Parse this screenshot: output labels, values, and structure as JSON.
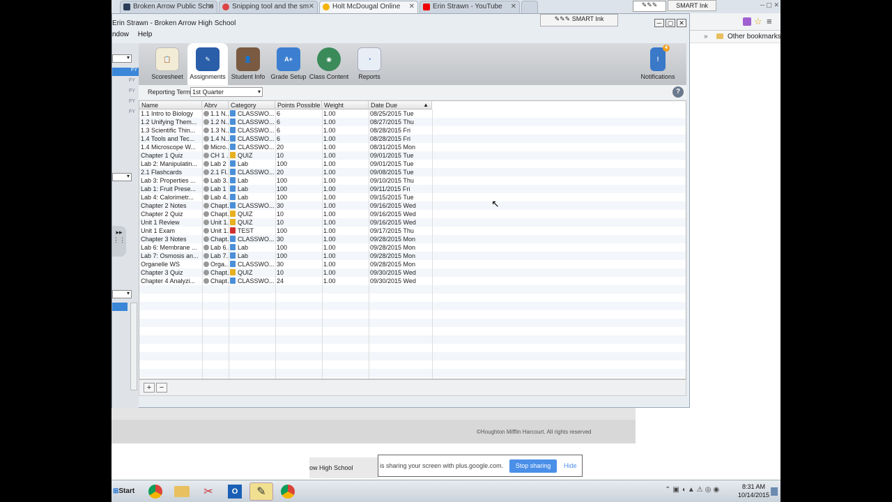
{
  "browser": {
    "tabs": [
      {
        "label": "Broken Arrow Public Scho",
        "color": "#2d3e5a"
      },
      {
        "label": "Snipping tool and the sm",
        "color": "#d44"
      },
      {
        "label": "Holt McDougal Online",
        "color": "#f5b400"
      },
      {
        "label": "Erin Strawn - YouTube",
        "color": "#e00"
      }
    ],
    "smart_ink": "SMART Ink",
    "bookmarks": "Other bookmarks"
  },
  "window": {
    "title": "Erin Strawn - Broken Arrow High School",
    "menu": [
      "ndow",
      "Help"
    ],
    "smart_ink": "SMART Ink"
  },
  "toolbar": {
    "items": [
      {
        "label": "Scoresheet",
        "icon": "scoresheet-icon"
      },
      {
        "label": "Assignments",
        "icon": "assignments-icon"
      },
      {
        "label": "Student Info",
        "icon": "student-info-icon"
      },
      {
        "label": "Grade Setup",
        "icon": "grade-setup-icon"
      },
      {
        "label": "Class Content",
        "icon": "class-content-icon"
      },
      {
        "label": "Reports",
        "icon": "reports-icon"
      }
    ],
    "notifications_label": "Notifications",
    "notifications_count": "4"
  },
  "reporting": {
    "label": "Reporting Term:",
    "value": "1st Quarter"
  },
  "left_labels": [
    "FY",
    "FY",
    "FY",
    "FY",
    "FY"
  ],
  "grid": {
    "columns": [
      "Name",
      "Abrv",
      "Category",
      "Points Possible",
      "Weight",
      "Date Due"
    ],
    "rows": [
      [
        "1.1 Intro to Biology",
        "1.1 N...",
        "CLASSWO...",
        "6",
        "1.00",
        "08/25/2015 Tue"
      ],
      [
        "1.2 Unifying Them...",
        "1.2 N...",
        "CLASSWO...",
        "6",
        "1.00",
        "08/27/2015 Thu"
      ],
      [
        "1.3 Scientific Thin...",
        "1.3 N...",
        "CLASSWO...",
        "6",
        "1.00",
        "08/28/2015 Fri"
      ],
      [
        "1.4 Tools and Tec...",
        "1.4 N...",
        "CLASSWO...",
        "6",
        "1.00",
        "08/28/2015 Fri"
      ],
      [
        "1.4 Microscope W...",
        "Micro...",
        "CLASSWO...",
        "20",
        "1.00",
        "08/31/2015 Mon"
      ],
      [
        "Chapter 1 Quiz",
        "CH 1 ...",
        "QUIZ",
        "10",
        "1.00",
        "09/01/2015 Tue"
      ],
      [
        "Lab 2: Manipulatin...",
        "Lab 2",
        "Lab",
        "100",
        "1.00",
        "09/01/2015 Tue"
      ],
      [
        "2.1 Flashcards",
        "2.1 Fl...",
        "CLASSWO...",
        "20",
        "1.00",
        "09/08/2015 Tue"
      ],
      [
        "Lab 3: Properties ...",
        "Lab 3...",
        "Lab",
        "100",
        "1.00",
        "09/10/2015 Thu"
      ],
      [
        "Lab 1: Fruit Prese...",
        "Lab 1",
        "Lab",
        "100",
        "1.00",
        "09/11/2015 Fri"
      ],
      [
        "Lab 4: Calorimetr...",
        "Lab 4...",
        "Lab",
        "100",
        "1.00",
        "09/15/2015 Tue"
      ],
      [
        "Chapter 2 Notes",
        "Chapt...",
        "CLASSWO...",
        "30",
        "1.00",
        "09/16/2015 Wed"
      ],
      [
        "Chapter 2 Quiz",
        "Chapt...",
        "QUIZ",
        "10",
        "1.00",
        "09/16/2015 Wed"
      ],
      [
        "Unit 1 Review",
        "Unit 1...",
        "QUIZ",
        "10",
        "1.00",
        "09/16/2015 Wed"
      ],
      [
        "Unit 1 Exam",
        "Unit 1...",
        "TEST",
        "100",
        "1.00",
        "09/17/2015 Thu"
      ],
      [
        "Chapter 3 Notes",
        "Chapt...",
        "CLASSWO...",
        "30",
        "1.00",
        "09/28/2015 Mon"
      ],
      [
        "Lab 6: Membrane ...",
        "Lab 6...",
        "Lab",
        "100",
        "1.00",
        "09/28/2015 Mon"
      ],
      [
        "Lab 7: Osmosis an...",
        "Lab 7...",
        "Lab",
        "100",
        "1.00",
        "09/28/2015 Mon"
      ],
      [
        "Organelle WS",
        "Orga...",
        "CLASSWO...",
        "30",
        "1.00",
        "09/28/2015 Mon"
      ],
      [
        "Chapter 3 Quiz",
        "Chapt...",
        "QUIZ",
        "10",
        "1.00",
        "09/30/2015 Wed"
      ],
      [
        "Chapter 4 Analyzi...",
        "Chapt...",
        "CLASSWO...",
        "24",
        "1.00",
        "09/30/2015 Wed"
      ]
    ],
    "category_colors": {
      "CLASSWO...": "#4a8fd8",
      "QUIZ": "#e8b020",
      "Lab": "#4a8fd8",
      "TEST": "#d03030"
    }
  },
  "grid_footer": {
    "add": "+",
    "remove": "−"
  },
  "footer": {
    "copyright": "©Houghton Mifflin Harcourt. All rights reserved"
  },
  "share": {
    "left_text": "ow High School",
    "message": "is sharing your screen with plus.google.com.",
    "stop": "Stop sharing",
    "hide": "Hide"
  },
  "taskbar": {
    "start": "Start",
    "time": "8:31 AM",
    "date": "10/14/2015"
  }
}
